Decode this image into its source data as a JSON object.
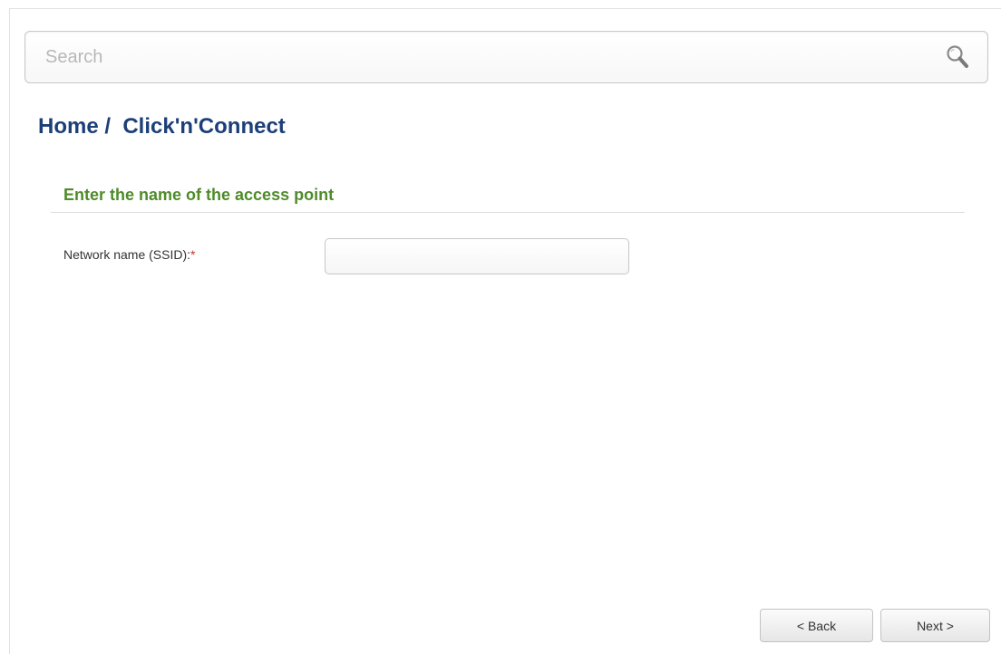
{
  "search": {
    "placeholder": "Search",
    "value": "",
    "icon": "search-icon"
  },
  "breadcrumb": {
    "text": "Home /  Click'n'Connect"
  },
  "section": {
    "title": "Enter the name of the access point"
  },
  "form": {
    "ssid_label": "Network name (SSID):",
    "required_mark": "*",
    "ssid_value": ""
  },
  "buttons": {
    "back_label": "< Back",
    "next_label": "Next >"
  },
  "colors": {
    "breadcrumb": "#1d3f78",
    "section_title": "#4f8b2a",
    "required": "#c0392b"
  }
}
